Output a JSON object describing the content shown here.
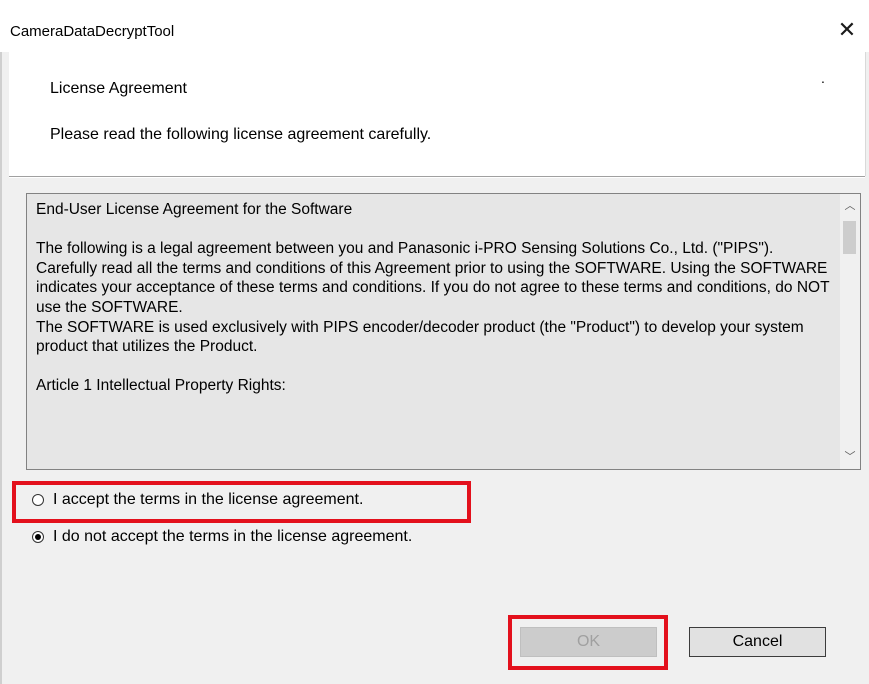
{
  "window": {
    "title": "CameraDataDecryptTool",
    "close_glyph": "✕"
  },
  "header": {
    "title": "License Agreement",
    "subtitle": "Please read the following license agreement carefully.",
    "dot": "."
  },
  "license": {
    "text": "End-User License Agreement for the Software\n\nThe following is a legal agreement between you and Panasonic i-PRO Sensing Solutions Co., Ltd. (\"PIPS\"). Carefully read all the terms and conditions of this Agreement prior to using the SOFTWARE. Using the SOFTWARE indicates your acceptance of these terms and conditions. If you do not agree to these terms and conditions, do NOT use the SOFTWARE.\nThe SOFTWARE is used exclusively with PIPS encoder/decoder product (the \"Product\") to develop your system product that utilizes the Product.\n\nArticle 1 Intellectual Property Rights:",
    "scroll_up_glyph": "︿",
    "scroll_down_glyph": "﹀"
  },
  "options": [
    {
      "label": "I accept the terms in the license agreement.",
      "checked": false
    },
    {
      "label": "I do not accept the terms in the license agreement.",
      "checked": true
    }
  ],
  "buttons": {
    "ok_label": "OK",
    "ok_enabled": false,
    "cancel_label": "Cancel"
  },
  "highlight_color": "#e3101c"
}
